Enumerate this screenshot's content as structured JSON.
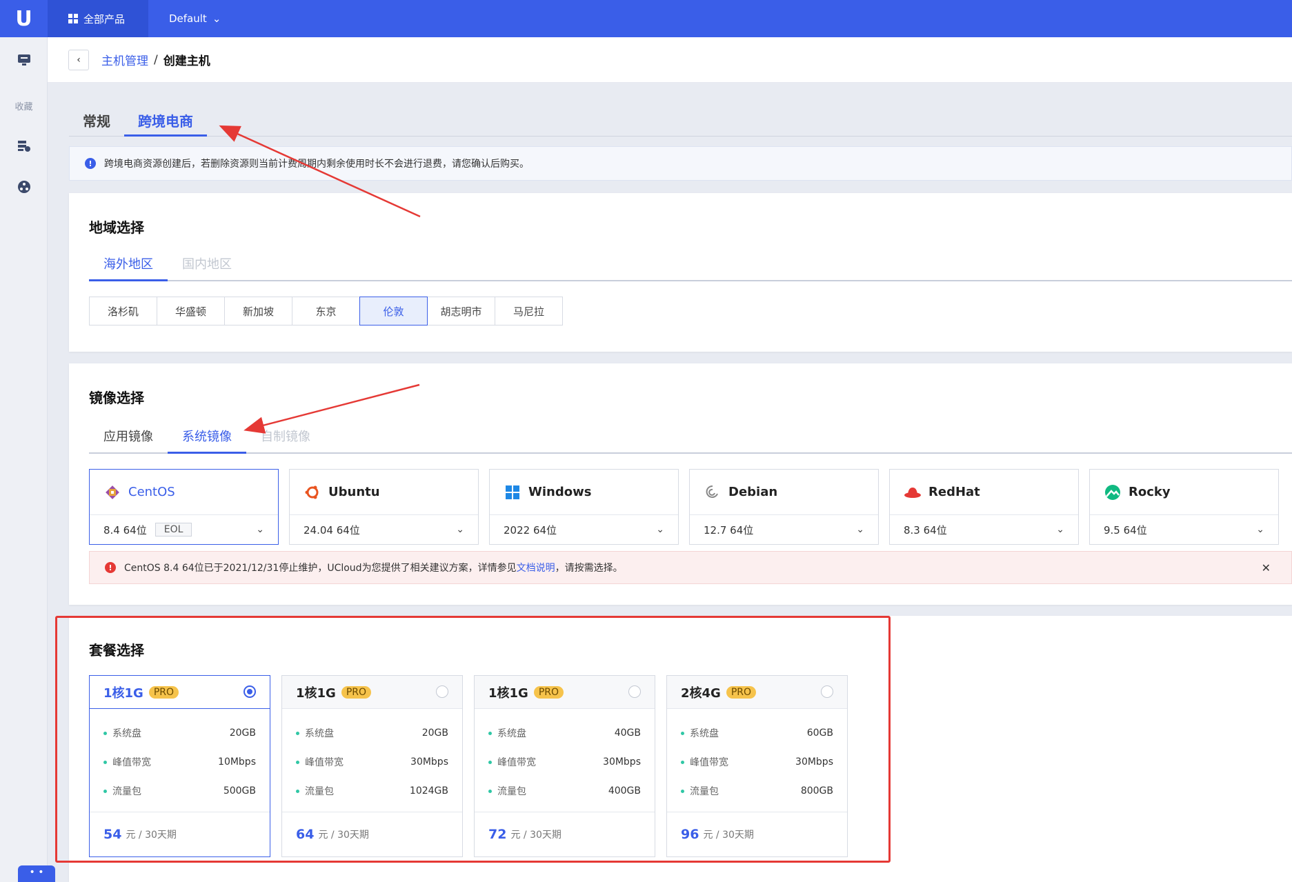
{
  "sidebar": {
    "logo": "U",
    "favorites_label": "收藏",
    "bottom_label": "• •",
    "icons": [
      "monitor-icon",
      "server-cloud-icon",
      "network-icon"
    ]
  },
  "topbar": {
    "all_products": "全部产品",
    "project": "Default",
    "project_chevron": "⌄"
  },
  "breadcrumb": {
    "back": "‹",
    "parent": "主机管理",
    "separator": "/",
    "current": "创建主机"
  },
  "top_tabs": [
    {
      "label": "常规",
      "active": false
    },
    {
      "label": "跨境电商",
      "active": true
    }
  ],
  "notice": {
    "icon": "!",
    "text": "跨境电商资源创建后，若删除资源则当前计费周期内剩余使用时长不会进行退费，请您确认后购买。"
  },
  "region": {
    "title": "地域选择",
    "tabs": [
      {
        "label": "海外地区",
        "state": "active"
      },
      {
        "label": "国内地区",
        "state": "disabled"
      }
    ],
    "options": [
      {
        "label": "洛杉矶",
        "active": false
      },
      {
        "label": "华盛顿",
        "active": false
      },
      {
        "label": "新加坡",
        "active": false
      },
      {
        "label": "东京",
        "active": false
      },
      {
        "label": "伦敦",
        "active": true
      },
      {
        "label": "胡志明市",
        "active": false
      },
      {
        "label": "马尼拉",
        "active": false
      }
    ]
  },
  "image": {
    "title": "镜像选择",
    "tabs": [
      {
        "label": "应用镜像",
        "state": "normal"
      },
      {
        "label": "系统镜像",
        "state": "active"
      },
      {
        "label": "自制镜像",
        "state": "disabled"
      }
    ],
    "options": [
      {
        "name": "CentOS",
        "version": "8.4 64位",
        "badge": "EOL",
        "active": true,
        "icon": "centos-icon"
      },
      {
        "name": "Ubuntu",
        "version": "24.04 64位",
        "badge": "",
        "active": false,
        "icon": "ubuntu-icon"
      },
      {
        "name": "Windows",
        "version": "2022 64位",
        "badge": "",
        "active": false,
        "icon": "windows-icon"
      },
      {
        "name": "Debian",
        "version": "12.7 64位",
        "badge": "",
        "active": false,
        "icon": "debian-icon"
      },
      {
        "name": "RedHat",
        "version": "8.3 64位",
        "badge": "",
        "active": false,
        "icon": "redhat-icon"
      },
      {
        "name": "Rocky",
        "version": "9.5 64位",
        "badge": "",
        "active": false,
        "icon": "rocky-icon"
      }
    ],
    "chevron": "⌄",
    "warning": {
      "icon": "!",
      "text_before": "CentOS 8.4 64位已于2021/12/31停止维护，UCloud为您提供了相关建议方案，详情参见",
      "link": "文档说明",
      "text_after": "，请按需选择。",
      "close": "✕"
    }
  },
  "plan": {
    "title": "套餐选择",
    "spec_labels": [
      "系统盘",
      "峰值带宽",
      "流量包"
    ],
    "price_unit": "元 / 30天期",
    "options": [
      {
        "name": "1核1G",
        "badge": "PRO",
        "selected": true,
        "disk": "20GB",
        "bandwidth": "10Mbps",
        "traffic": "500GB",
        "price": "54"
      },
      {
        "name": "1核1G",
        "badge": "PRO",
        "selected": false,
        "disk": "20GB",
        "bandwidth": "30Mbps",
        "traffic": "1024GB",
        "price": "64"
      },
      {
        "name": "1核1G",
        "badge": "PRO",
        "selected": false,
        "disk": "40GB",
        "bandwidth": "30Mbps",
        "traffic": "400GB",
        "price": "72"
      },
      {
        "name": "2核4G",
        "badge": "PRO",
        "selected": false,
        "disk": "60GB",
        "bandwidth": "30Mbps",
        "traffic": "800GB",
        "price": "96"
      }
    ]
  },
  "colors": {
    "primary": "#3a5ee8",
    "annotation": "#e53935",
    "pro_badge": "#f6c34b",
    "bullet": "#2fc7a5"
  }
}
